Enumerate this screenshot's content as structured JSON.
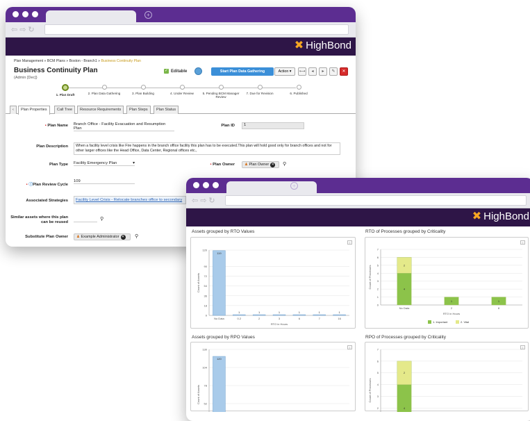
{
  "back_window": {
    "brand": "HighBond",
    "breadcrumb": [
      "Plan Management",
      "BCM Plans",
      "Boston - Branch1",
      "Business Continuity Plan"
    ],
    "page_title": "Business Continuity Plan",
    "page_subtitle": "(Admin [Dec])",
    "editable_label": "Editable",
    "start_button": "Start Plan Data Gathering",
    "action_button": "Action ▾",
    "steps": [
      "1. Plan Draft",
      "2. Plan Data Gathering",
      "3. Plan Building",
      "4. Under Review",
      "5. Pending BCM Manager Review",
      "7. Due for Revision",
      "6. Published"
    ],
    "tabs": [
      "Plan Properties",
      "Call Tree",
      "Resource Requirements",
      "Plan Steps",
      "Plan Status"
    ],
    "fields": {
      "plan_name_label": "Plan Name",
      "plan_name_value": "Branch Office - Facility Evacuation and Resumption Plan",
      "plan_id_label": "Plan ID",
      "plan_id_value": "1",
      "plan_desc_label": "Plan Description",
      "plan_desc_value": "When a facility level crisis like Fire happens in the branch office facility this plan has to be executed.This plan will hold good only for branch offices and not for other larger offices like the Head Office, Data Center, Regional offices etc.,",
      "plan_type_label": "Plan Type",
      "plan_type_value": "Facility Emergency Plan",
      "plan_owner_label": "Plan Owner",
      "plan_owner_value": "Plan Owner",
      "review_cycle_label": "Plan Review Cycle",
      "review_cycle_value": "109",
      "strategies_label": "Associated Strategies",
      "strategies_value": "Facility Level Crisis - Relocate branches office to secondary",
      "similar_label": "Similar assets where this plan can be reused",
      "sub_owner_label": "Substitute Plan Owner",
      "sub_owner_value": "Example Administrator"
    }
  },
  "front_window": {
    "brand": "HighBond",
    "panel_titles": [
      "Assets grouped by RTO Values",
      "RTO of Processes grouped by Criticality",
      "Assets grouped by RPO Values",
      "RPO of Processes grouped by Criticality"
    ]
  },
  "chart_data": [
    {
      "type": "bar",
      "title": "Assets grouped by RTO Values",
      "xlabel": "RTO in Hours",
      "ylabel": "Count of Assets",
      "categories": [
        "No Data",
        "0.2",
        "2",
        "3",
        "6",
        "7",
        "16"
      ],
      "values": [
        119,
        1,
        1,
        1,
        1,
        1,
        1
      ],
      "yticks": [
        0,
        18,
        36,
        54,
        72,
        90,
        120
      ],
      "ylim": [
        0,
        120
      ]
    },
    {
      "type": "bar",
      "stacked": true,
      "title": "RTO of Processes grouped by Criticality",
      "xlabel": "RTO in Hours",
      "ylabel": "Count of Processes",
      "categories": [
        "No Data",
        "2",
        "8"
      ],
      "series": [
        {
          "name": "1. Important",
          "values": [
            4,
            1,
            1
          ],
          "color": "#8cc34a"
        },
        {
          "name": "2. Vital",
          "values": [
            2,
            0,
            0
          ],
          "color": "#e4e98a"
        }
      ],
      "ylim": [
        0,
        7
      ],
      "legend": "bottom"
    },
    {
      "type": "bar",
      "title": "Assets grouped by RPO Values",
      "ylabel": "Count of Assets",
      "categories": [
        "No Data"
      ],
      "values": [
        120
      ],
      "yticks": [
        26,
        52,
        78,
        104,
        130
      ],
      "ylim": [
        0,
        130
      ]
    },
    {
      "type": "bar",
      "stacked": true,
      "title": "RPO of Processes grouped by Criticality",
      "ylabel": "Count of Processes",
      "categories": [
        "No Data",
        "",
        ""
      ],
      "series": [
        {
          "name": "1. Important",
          "values": [
            4,
            1,
            1
          ],
          "color": "#8cc34a"
        },
        {
          "name": "2. Vital",
          "values": [
            2,
            0,
            0
          ],
          "color": "#e4e98a"
        }
      ],
      "ylim": [
        0,
        7
      ]
    }
  ]
}
